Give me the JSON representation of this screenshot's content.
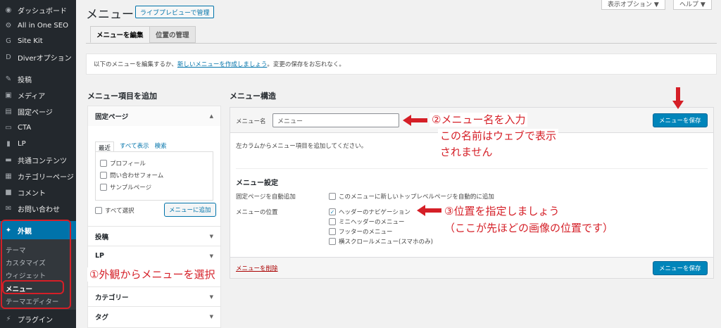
{
  "sidebar": {
    "items": [
      {
        "label": "ダッシュボード",
        "icon": "dashboard-icon",
        "glyph": "◉"
      },
      {
        "label": "All in One SEO",
        "icon": "seo-icon",
        "glyph": "⚙"
      },
      {
        "label": "Site Kit",
        "icon": "sitekit-icon",
        "glyph": "G"
      },
      {
        "label": "Diverオプション",
        "icon": "diver-icon",
        "glyph": "D"
      },
      {
        "label": "投稿",
        "icon": "pin-icon",
        "glyph": "✎"
      },
      {
        "label": "メディア",
        "icon": "media-icon",
        "glyph": "▣"
      },
      {
        "label": "固定ページ",
        "icon": "page-icon",
        "glyph": "▤"
      },
      {
        "label": "CTA",
        "icon": "cta-icon",
        "glyph": "▭"
      },
      {
        "label": "LP",
        "icon": "lp-icon",
        "glyph": "▮"
      },
      {
        "label": "共通コンテンツ",
        "icon": "folder-icon",
        "glyph": "▬"
      },
      {
        "label": "カテゴリーページ",
        "icon": "category-icon",
        "glyph": "▦"
      },
      {
        "label": "コメント",
        "icon": "comment-icon",
        "glyph": "■"
      },
      {
        "label": "お問い合わせ",
        "icon": "mail-icon",
        "glyph": "✉"
      },
      {
        "label": "外観",
        "icon": "appearance-icon",
        "glyph": "✦"
      },
      {
        "label": "プラグイン",
        "icon": "plugin-icon",
        "glyph": "⚡"
      }
    ],
    "submenu": [
      "テーマ",
      "カスタマイズ",
      "ウィジェット",
      "メニュー",
      "テーマエディター"
    ]
  },
  "header": {
    "screen_options": "表示オプション ▼",
    "help": "ヘルプ ▼",
    "title": "メニュー",
    "live_preview": "ライブプレビューで管理"
  },
  "tabs": [
    "メニューを編集",
    "位置の管理"
  ],
  "notice": {
    "before": "以下のメニューを編集するか、",
    "link": "新しいメニューを作成しましょう",
    "after": "。変更の保存をお忘れなく。"
  },
  "left": {
    "heading": "メニュー項目を追加",
    "pages_section": "固定ページ",
    "mini_tabs": [
      "最近",
      "すべて表示",
      "検索"
    ],
    "pages": [
      "プロフィール",
      "問い合わせフォーム",
      "サンプルページ"
    ],
    "select_all": "すべて選択",
    "add_button": "メニューに追加",
    "sections": [
      "投稿",
      "LP",
      "カテゴリー",
      "タグ"
    ]
  },
  "right": {
    "heading": "メニュー構造",
    "name_label": "メニュー名",
    "name_value": "メニュー",
    "save_button": "メニューを保存",
    "hint": "左カラムからメニュー項目を追加してください。",
    "settings_heading": "メニュー設定",
    "auto_add_label": "固定ページを自動追加",
    "auto_add_option": "このメニューに新しいトップレベルページを自動的に追加",
    "location_label": "メニューの位置",
    "locations": [
      {
        "label": "ヘッダーのナビゲーション",
        "checked": true
      },
      {
        "label": "ミニヘッダーのメニュー",
        "checked": false
      },
      {
        "label": "フッターのメニュー",
        "checked": false
      },
      {
        "label": "横スクロールメニュー(スマホのみ)",
        "checked": false
      }
    ],
    "delete_link": "メニューを削除"
  },
  "annotations": {
    "step1": "①外観からメニューを選択",
    "step2a": "②メニュー名を入力",
    "step2b": "この名前はウェブで表示",
    "step2c": "されません",
    "step3a": "③位置を指定しましょう",
    "step3b": "（ここが先ほどの画像の位置です）"
  },
  "colors": {
    "annotation": "#d51f27",
    "primary": "#0085ba",
    "sidebar": "#23282d"
  }
}
